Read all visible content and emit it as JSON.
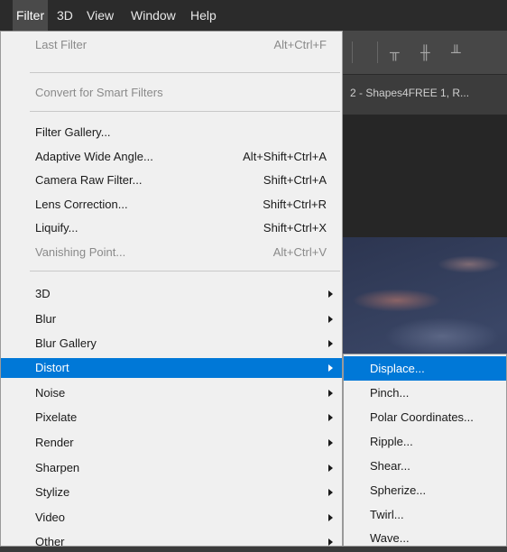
{
  "menubar": {
    "items": [
      {
        "label": "Filter",
        "active": true
      },
      {
        "label": "3D",
        "active": false
      },
      {
        "label": "View",
        "active": false
      },
      {
        "label": "Window",
        "active": false
      },
      {
        "label": "Help",
        "active": false
      }
    ]
  },
  "document": {
    "tab_title": "2 - Shapes4FREE 1, R..."
  },
  "filter_menu": {
    "last_filter": {
      "label": "Last Filter",
      "shortcut": "Alt+Ctrl+F"
    },
    "convert_smart": {
      "label": "Convert for Smart Filters"
    },
    "filter_gallery": {
      "label": "Filter Gallery..."
    },
    "adaptive_wide_angle": {
      "label": "Adaptive Wide Angle...",
      "shortcut": "Alt+Shift+Ctrl+A"
    },
    "camera_raw": {
      "label": "Camera Raw Filter...",
      "shortcut": "Shift+Ctrl+A"
    },
    "lens_correction": {
      "label": "Lens Correction...",
      "shortcut": "Shift+Ctrl+R"
    },
    "liquify": {
      "label": "Liquify...",
      "shortcut": "Shift+Ctrl+X"
    },
    "vanishing_point": {
      "label": "Vanishing Point...",
      "shortcut": "Alt+Ctrl+V"
    },
    "submenus": [
      "3D",
      "Blur",
      "Blur Gallery",
      "Distort",
      "Noise",
      "Pixelate",
      "Render",
      "Sharpen",
      "Stylize",
      "Video",
      "Other"
    ],
    "highlighted": "Distort"
  },
  "distort_submenu": {
    "items": [
      "Displace...",
      "Pinch...",
      "Polar Coordinates...",
      "Ripple...",
      "Shear...",
      "Spherize...",
      "Twirl...",
      "Wave..."
    ],
    "highlighted": "Displace..."
  },
  "colors": {
    "highlight": "#0078d7",
    "menu_bg": "#f0f0f0",
    "menubar_bg": "#2b2b2b"
  }
}
